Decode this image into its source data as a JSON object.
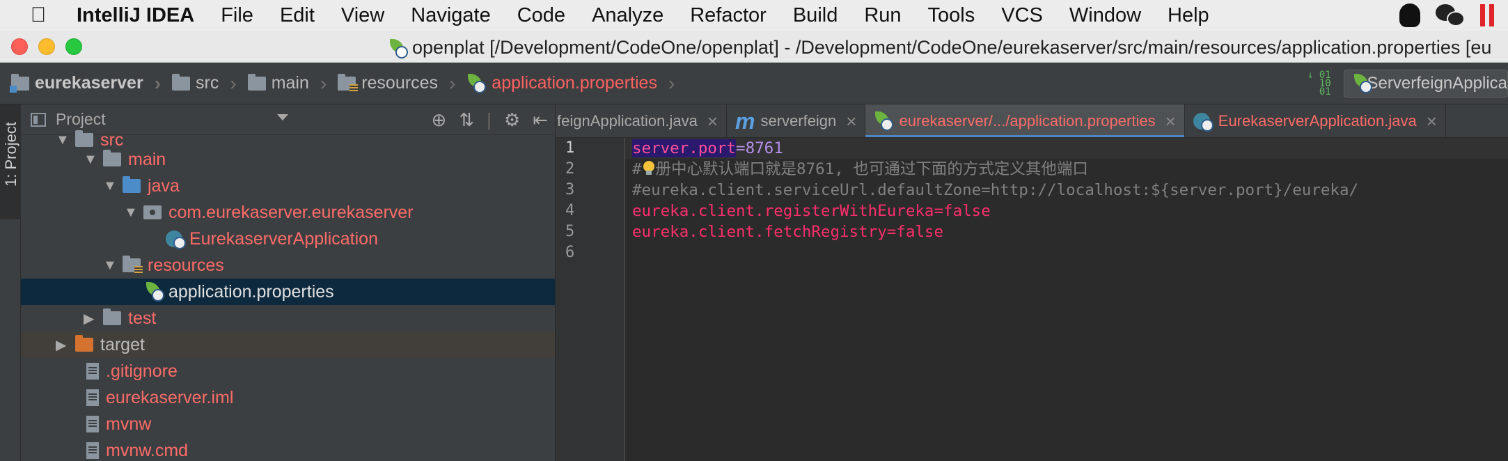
{
  "menubar": {
    "app_name": "IntelliJ IDEA",
    "items": [
      "File",
      "Edit",
      "View",
      "Navigate",
      "Code",
      "Analyze",
      "Refactor",
      "Build",
      "Run",
      "Tools",
      "VCS",
      "Window",
      "Help"
    ],
    "right_icons": [
      "qq-icon",
      "wechat-icon",
      "pause-icon"
    ]
  },
  "window": {
    "title": "openplat [/Development/CodeOne/openplat] - /Development/CodeOne/eurekaserver/src/main/resources/application.properties [eu"
  },
  "breadcrumb": {
    "items": [
      "eurekaserver",
      "src",
      "main",
      "resources",
      "application.properties"
    ],
    "run_config": "ServerfeignApplica"
  },
  "tool_stripe": {
    "project_tab": "1: Project"
  },
  "project_panel": {
    "view_selector": "Project",
    "tree": [
      {
        "label": "src",
        "depth": 1,
        "expanded": true,
        "icon": "folder",
        "color": "red"
      },
      {
        "label": "main",
        "depth": 2,
        "expanded": true,
        "icon": "folder",
        "color": "red"
      },
      {
        "label": "java",
        "depth": 3,
        "expanded": true,
        "icon": "source-folder",
        "color": "red"
      },
      {
        "label": "com.eurekaserver.eurekaserver",
        "depth": 4,
        "expanded": true,
        "icon": "package",
        "color": "red"
      },
      {
        "label": "EurekaserverApplication",
        "depth": 5,
        "icon": "spring-class",
        "color": "red"
      },
      {
        "label": "resources",
        "depth": 3,
        "expanded": true,
        "icon": "resources-folder",
        "color": "red"
      },
      {
        "label": "application.properties",
        "depth": 4,
        "icon": "spring-leaf",
        "color": "white",
        "selected": true
      },
      {
        "label": "test",
        "depth": 2,
        "expanded": false,
        "icon": "folder",
        "color": "red"
      },
      {
        "label": "target",
        "depth": 1,
        "expanded": false,
        "icon": "folder-orange",
        "color": "gray",
        "highlight": true
      },
      {
        "label": ".gitignore",
        "depth": 1,
        "icon": "file",
        "color": "red"
      },
      {
        "label": "eurekaserver.iml",
        "depth": 1,
        "icon": "file",
        "color": "red"
      },
      {
        "label": "mvnw",
        "depth": 1,
        "icon": "file",
        "color": "red"
      },
      {
        "label": "mvnw.cmd",
        "depth": 1,
        "icon": "file",
        "color": "red"
      }
    ]
  },
  "editor_tabs": [
    {
      "label": "feignApplication.java",
      "icon": "none",
      "active": false
    },
    {
      "label": "serverfeign",
      "icon": "maven-m",
      "active": false
    },
    {
      "label": "eurekaserver/.../application.properties",
      "icon": "spring-leaf",
      "active": true
    },
    {
      "label": "EurekaserverApplication.java",
      "icon": "spring-class",
      "active": false
    }
  ],
  "editor": {
    "line_numbers": [
      "1",
      "2",
      "3",
      "4",
      "5",
      "6"
    ],
    "lines": {
      "l1_key": "server.port",
      "l1_eq": "=",
      "l1_val": "8761",
      "l2_hash": "#",
      "l2_text": "册中心默认端口就是8761, 也可通过下面的方式定义其他端口",
      "l3": "#eureka.client.serviceUrl.defaultZone=http://localhost:${server.port}/eureka/",
      "l4": "eureka.client.registerWithEureka=false",
      "l5": "eureka.client.fetchRegistry=false",
      "l6": ""
    }
  },
  "colors": {
    "ide_bg": "#2b2b2b",
    "panel_bg": "#3c3f41",
    "vcs_modified_red": "#ff6b68",
    "selection_bg": "#0d293e",
    "tab_underline": "#4a88c7"
  }
}
